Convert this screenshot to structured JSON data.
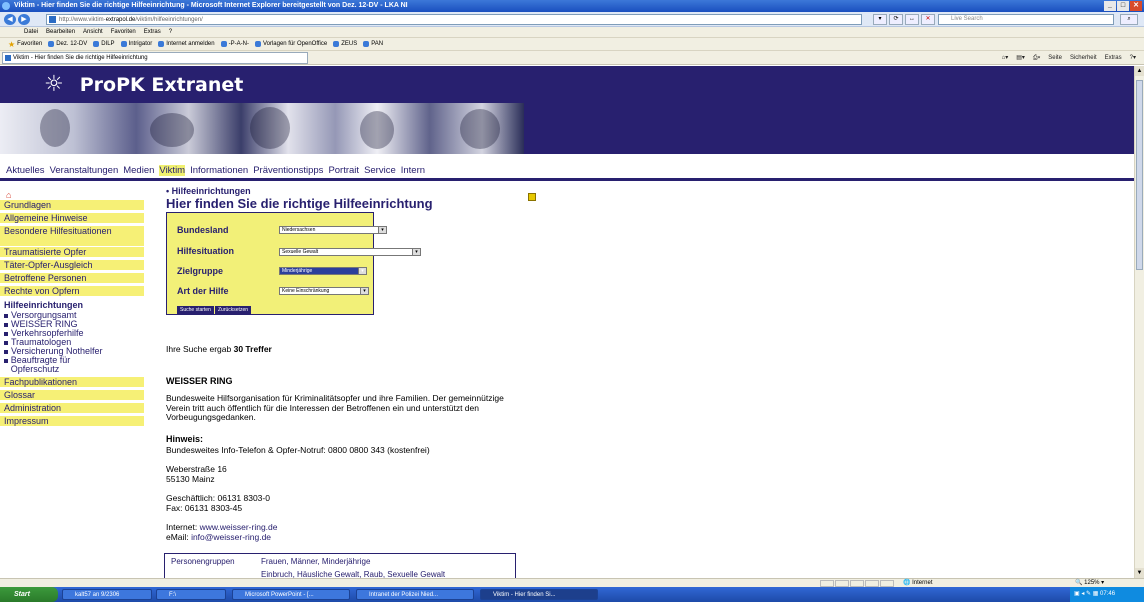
{
  "window": {
    "title": "Viktim - Hier finden Sie die richtige Hilfeeinrichtung - Microsoft Internet Explorer bereitgestellt von Dez. 12-DV - LKA NI"
  },
  "browser": {
    "url_prefix": "http://www.viktim-",
    "url_host": "extrapol.de",
    "url_rest": "/viktim/hilfeeinrichtungen/",
    "search_placeholder": "Live Search",
    "menu": [
      "Datei",
      "Bearbeiten",
      "Ansicht",
      "Favoriten",
      "Extras",
      "?"
    ],
    "favorites": [
      "Favoriten",
      "Dez. 12-DV",
      "DILP",
      "Intrigator",
      "Internet anmelden",
      "-P-A-N-",
      "Vorlagen für OpenOffice",
      "ZEUS",
      "PAN"
    ],
    "tab": "Viktim - Hier finden Sie die richtige Hilfeeinrichtung",
    "commands": [
      "Seite",
      "Sicherheit",
      "Extras"
    ]
  },
  "site": {
    "logo": "ProPK Extranet",
    "nav": [
      "Aktuelles",
      "Veranstaltungen",
      "Medien",
      "Viktim",
      "Informationen",
      "Präventionstipps",
      "Portrait",
      "Service",
      "Intern"
    ],
    "nav_active": "Viktim"
  },
  "sidebar": {
    "top": [
      "Grundlagen",
      "Allgemeine Hinweise",
      "Besondere Hilfesituationen",
      "Traumatisierte Opfer",
      "Täter-Opfer-Ausgleich",
      "Betroffene Personen",
      "Rechte von Opfern"
    ],
    "section": "Hilfeeinrichtungen",
    "sub": [
      "Versorgungsamt",
      "WEISSER RING",
      "Verkehrsopferhilfe",
      "Traumatologen",
      "Versicherung Nothelfer",
      "Beauftragte für Opferschutz"
    ],
    "bottom": [
      "Fachpublikationen",
      "Glossar",
      "Administration",
      "Impressum"
    ]
  },
  "main": {
    "crumb": "Hilfeeinrichtungen",
    "title": "Hier finden Sie die richtige Hilfeeinrichtung",
    "form": {
      "bundesland_label": "Bundesland",
      "bundesland_value": "Niedersachsen",
      "situation_label": "Hilfesituation",
      "situation_value": "Sexuelle Gewalt",
      "zielgruppe_label": "Zielgruppe",
      "zielgruppe_value": "Minderjährige",
      "art_label": "Art der Hilfe",
      "art_value": "Keine Einschränkung",
      "search_button": "Suche starten",
      "reset_button": "Zurücksetzen"
    },
    "result_prefix": "Ihre Suche ergab",
    "result_count": "30 Treffer",
    "org_name": "WEISSER RING",
    "org_desc": "Bundesweite Hilfsorganisation für Kriminalitätsopfer und ihre Familien. Der gemeinnützige Verein tritt auch öffentlich für die Interessen der Betroffenen ein und unterstützt den Vorbeugungsgedanken.",
    "hinweis_label": "Hinweis:",
    "hinweis_text": "Bundesweites Info-Telefon & Opfer-Notruf: 0800 0800 343 (kostenfrei)",
    "street": "Weberstraße 16",
    "city": "55130 Mainz",
    "phone": "Geschäftlich: 06131 8303-0",
    "fax": "Fax: 06131 8303-45",
    "internet_label": "Internet:",
    "internet": "www.weisser-ring.de",
    "email_label": "eMail:",
    "email": "info@weisser-ring.de",
    "table_key": "Personengruppen",
    "table_val": "Frauen, Männer, Minderjährige",
    "table_val2": "Einbruch, Häusliche Gewalt, Raub, Sexuelle Gewalt"
  },
  "status": {
    "zone": "Internet",
    "zoom": "125%"
  },
  "taskbar": {
    "start": "Start",
    "items": [
      "kalt57 an 9/2306",
      "F:\\",
      "Microsoft PowerPoint - [...",
      "Intranet der Polizei Nied...",
      "Viktim - Hier finden Si..."
    ],
    "clock": "07:46"
  }
}
